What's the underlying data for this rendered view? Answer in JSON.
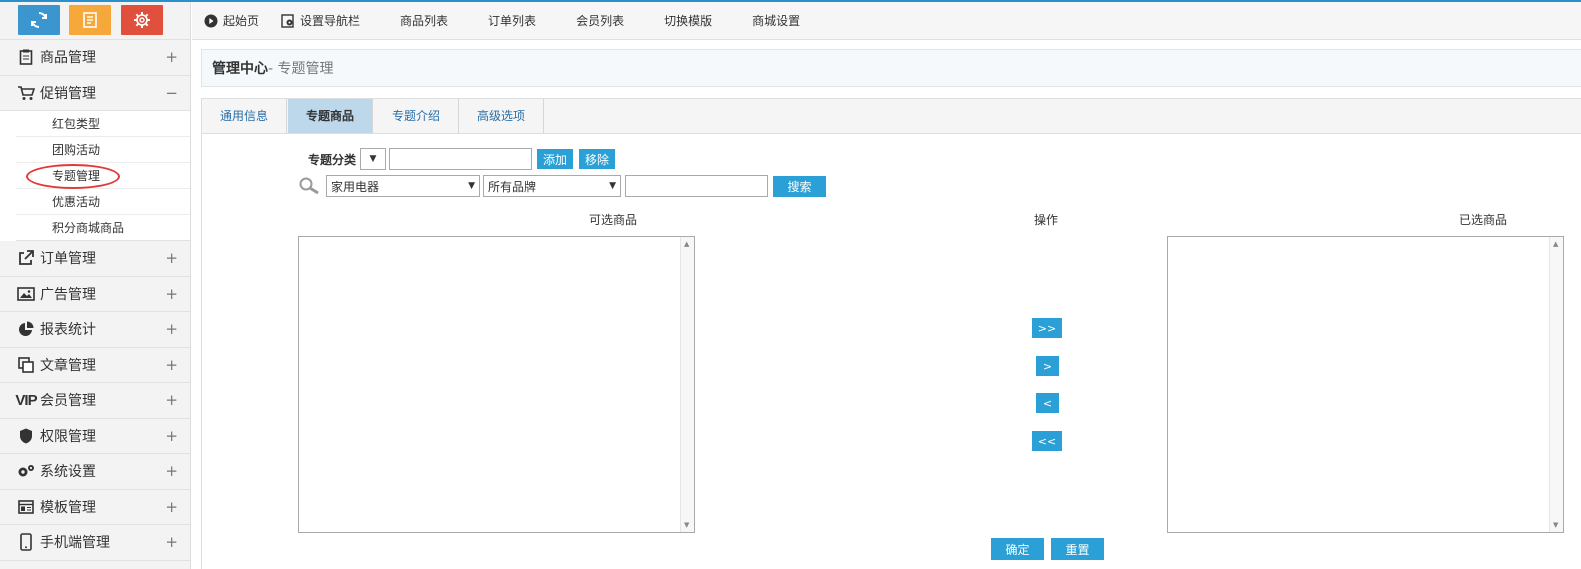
{
  "sidebar": {
    "top_buttons": [
      {
        "icon": "refresh-icon",
        "color": "#3b96d0"
      },
      {
        "icon": "notepad-icon",
        "color": "#f6a83a"
      },
      {
        "icon": "gear-icon",
        "color": "#e0503c"
      }
    ],
    "menu": [
      {
        "label": "商品管理",
        "icon": "clipboard-icon",
        "toggle": "+"
      },
      {
        "label": "促销管理",
        "icon": "cart-icon",
        "toggle": "−",
        "expanded": true,
        "children": [
          "红包类型",
          "团购活动",
          "专题管理",
          "优惠活动",
          "积分商城商品"
        ]
      },
      {
        "label": "订单管理",
        "icon": "external-link-icon",
        "toggle": "+"
      },
      {
        "label": "广告管理",
        "icon": "image-icon",
        "toggle": "+"
      },
      {
        "label": "报表统计",
        "icon": "pie-chart-icon",
        "toggle": "+"
      },
      {
        "label": "文章管理",
        "icon": "copy-icon",
        "toggle": "+"
      },
      {
        "label": "会员管理",
        "icon": "vip-icon",
        "toggle": "+"
      },
      {
        "label": "权限管理",
        "icon": "shield-icon",
        "toggle": "+"
      },
      {
        "label": "系统设置",
        "icon": "gears-icon",
        "toggle": "+"
      },
      {
        "label": "模板管理",
        "icon": "template-icon",
        "toggle": "+"
      },
      {
        "label": "手机端管理",
        "icon": "mobile-icon",
        "toggle": "+"
      }
    ]
  },
  "topnav": [
    {
      "label": "起始页",
      "icon": "play-circle-icon"
    },
    {
      "label": "设置导航栏",
      "icon": "settings-doc-icon"
    },
    {
      "label": "商品列表"
    },
    {
      "label": "订单列表"
    },
    {
      "label": "会员列表"
    },
    {
      "label": "切换模版"
    },
    {
      "label": "商城设置"
    }
  ],
  "title": {
    "main": "管理中心",
    "sub": "- 专题管理"
  },
  "tabs": [
    "通用信息",
    "专题商品",
    "专题介绍",
    "高级选项"
  ],
  "form": {
    "category_label": "专题分类",
    "category_select": "▼",
    "add_btn": "添加",
    "remove_btn": "移除",
    "cat_select": "家用电器",
    "brand_select": "所有品牌",
    "search_btn": "搜索"
  },
  "columns": {
    "available": "可选商品",
    "action": "操作",
    "selected": "已选商品"
  },
  "ops": [
    ">>",
    ">",
    "<",
    "<<"
  ],
  "footer": {
    "confirm": "确定",
    "reset": "重置"
  },
  "colors": {
    "accent": "#2aa0d6",
    "highlight": "#e03a3a"
  }
}
